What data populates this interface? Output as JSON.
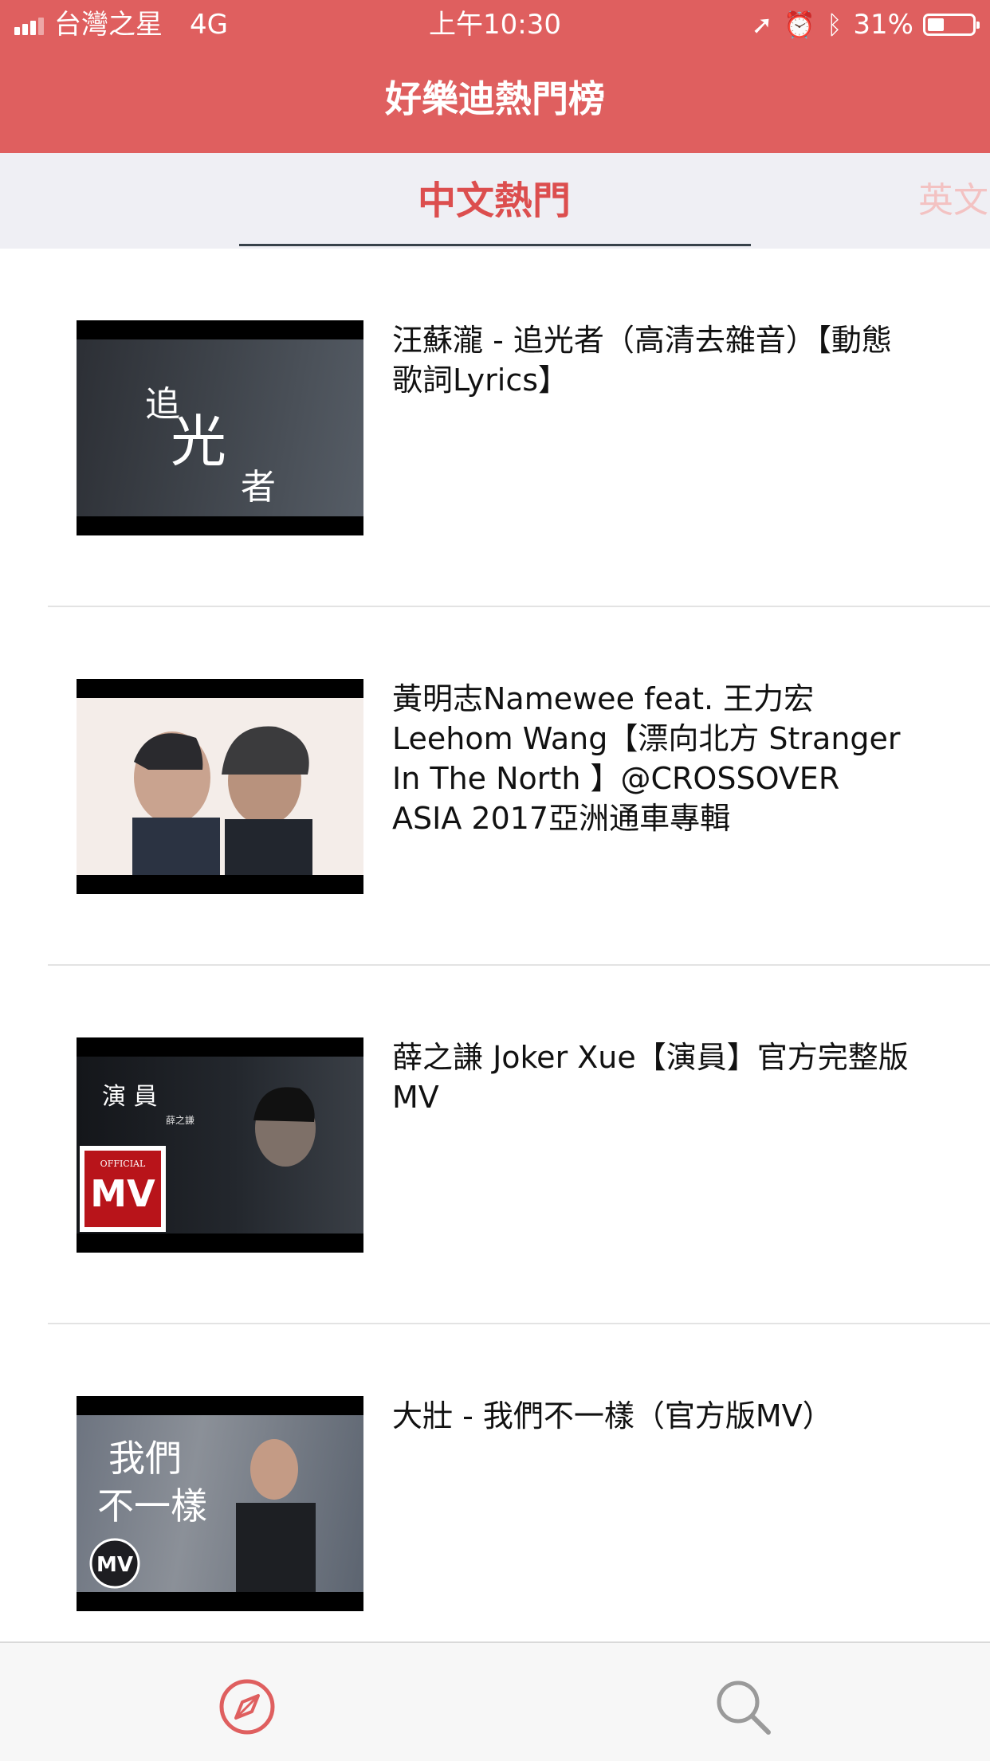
{
  "status_bar": {
    "carrier": "台灣之星",
    "network": "4G",
    "time": "上午10:30",
    "battery": "31%",
    "battery_level": 0.31
  },
  "header": {
    "title": "好樂迪熱門榜"
  },
  "tabs": [
    {
      "label": "中文熱門",
      "active": true
    },
    {
      "label": "英文"
    }
  ],
  "videos": [
    {
      "title": "汪蘇瀧 - 追光者（高清去雜音）【動態歌詞Lyrics】",
      "thumb_text": [
        "追",
        "光",
        "者"
      ]
    },
    {
      "title": "黃明志Namewee feat. 王力宏 Leehom Wang【漂向北方 Stranger In The North 】@CROSSOVER ASIA 2017亞洲通車專輯"
    },
    {
      "title": "薛之謙 Joker Xue【演員】官方完整版 MV",
      "thumb_text": [
        "演 員",
        "薛之謙",
        "OFFICIAL",
        "MV"
      ]
    },
    {
      "title": "大壯 - 我們不一樣（官方版MV）",
      "thumb_text": [
        "我們",
        "不一樣",
        "MV"
      ]
    }
  ],
  "tabbar": [
    {
      "name": "compass-icon",
      "active": true
    },
    {
      "name": "search-icon",
      "active": false
    }
  ],
  "colors": {
    "accent": "#df5f5f",
    "tab_active": "#dc4e4e"
  }
}
